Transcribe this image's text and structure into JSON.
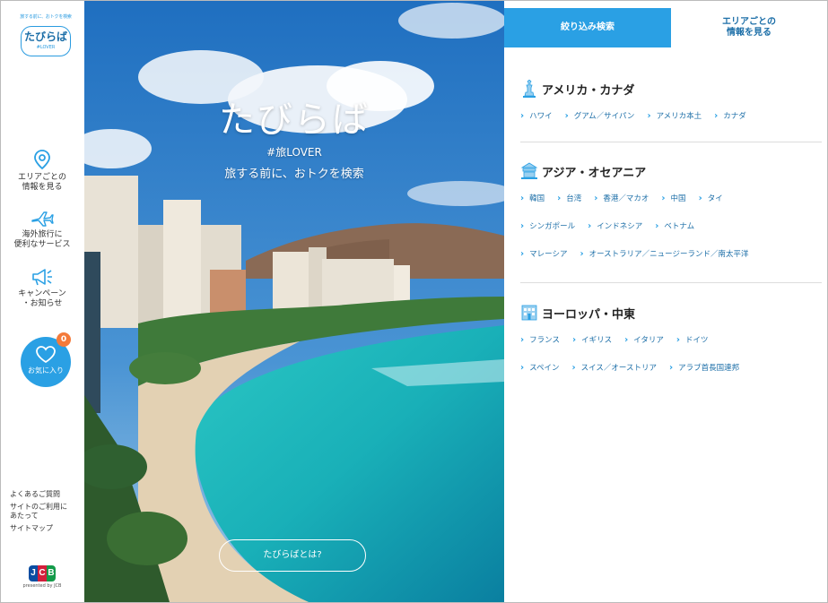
{
  "sidebar": {
    "logo": {
      "arc": "旅する前に、おトクを検索",
      "main": "たびらば",
      "sub": "#LOVER"
    },
    "nav": [
      {
        "label": "エリアごとの\n情報を見る",
        "icon": "map-pin-icon"
      },
      {
        "label": "海外旅行に\n便利なサービス",
        "icon": "airplane-icon"
      },
      {
        "label": "キャンペーン\n・お知らせ",
        "icon": "megaphone-icon"
      }
    ],
    "favorite": {
      "label": "お気に入り",
      "count": "0",
      "icon": "heart-icon"
    },
    "footer_links": [
      {
        "label": "よくあるご質問"
      },
      {
        "label": "サイトのご利用に\nあたって"
      },
      {
        "label": "サイトマップ"
      }
    ],
    "jcb": {
      "logo": [
        "J",
        "C",
        "B"
      ],
      "presented": "presented by JCB"
    }
  },
  "hero": {
    "title": "たびらば",
    "tag": "#旅LOVER",
    "subtitle": "旅する前に、おトクを検索",
    "button": "たびらばとは?"
  },
  "panel": {
    "tabs": [
      {
        "label": "絞り込み検索",
        "active": true
      },
      {
        "label": "エリアごとの\n情報を見る",
        "active": false
      }
    ],
    "regions": [
      {
        "title": "アメリカ・カナダ",
        "icon": "statue-of-liberty-icon",
        "rows": [
          [
            "ハワイ",
            "グアム／サイパン",
            "アメリカ本土",
            "カナダ"
          ]
        ]
      },
      {
        "title": "アジア・オセアニア",
        "icon": "temple-icon",
        "rows": [
          [
            "韓国",
            "台湾",
            "香港／マカオ",
            "中国",
            "タイ"
          ],
          [
            "シンガポール",
            "インドネシア",
            "ベトナム"
          ],
          [
            "マレーシア",
            "オーストラリア／ニュージーランド／南太平洋"
          ]
        ]
      },
      {
        "title": "ヨーロッパ・中東",
        "icon": "building-icon",
        "rows": [
          [
            "フランス",
            "イギリス",
            "イタリア",
            "ドイツ"
          ],
          [
            "スペイン",
            "スイス／オーストリア",
            "アラブ首長国連邦"
          ]
        ]
      }
    ]
  },
  "colors": {
    "accent": "#2aa0e4",
    "link": "#1d6fa8",
    "badge": "#f47a3a"
  }
}
